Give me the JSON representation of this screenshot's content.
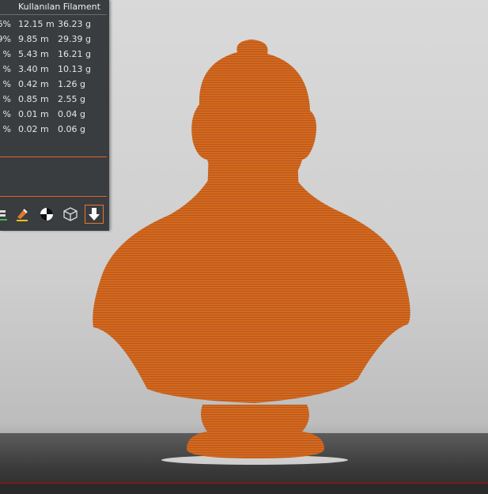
{
  "stats_panel": {
    "column_header": "Kullanılan Filament",
    "rows": [
      {
        "pct": "6%",
        "length": "12.15 m",
        "weight": "36.23 g"
      },
      {
        "pct": "9%",
        "length": "9.85 m",
        "weight": "29.39 g"
      },
      {
        "pct": "%",
        "length": "5.43 m",
        "weight": "16.21 g"
      },
      {
        "pct": "%",
        "length": "3.40 m",
        "weight": "10.13 g"
      },
      {
        "pct": "%",
        "length": "0.42 m",
        "weight": "1.26 g"
      },
      {
        "pct": "%",
        "length": "0.85 m",
        "weight": "2.55 g"
      },
      {
        "pct": "%",
        "length": "0.01 m",
        "weight": "0.04 g"
      },
      {
        "pct": "%",
        "length": "0.02 m",
        "weight": "0.06 g"
      }
    ]
  },
  "toolbar": {
    "tools": [
      {
        "icon": "layers-icon"
      },
      {
        "icon": "paint-brush-icon"
      },
      {
        "icon": "color-balance-icon"
      },
      {
        "icon": "wireframe-cube-icon"
      },
      {
        "icon": "download-arrow-icon",
        "active": true
      }
    ]
  },
  "model": {
    "color": "#d46a1f",
    "plate_color": "#4a4d52"
  }
}
